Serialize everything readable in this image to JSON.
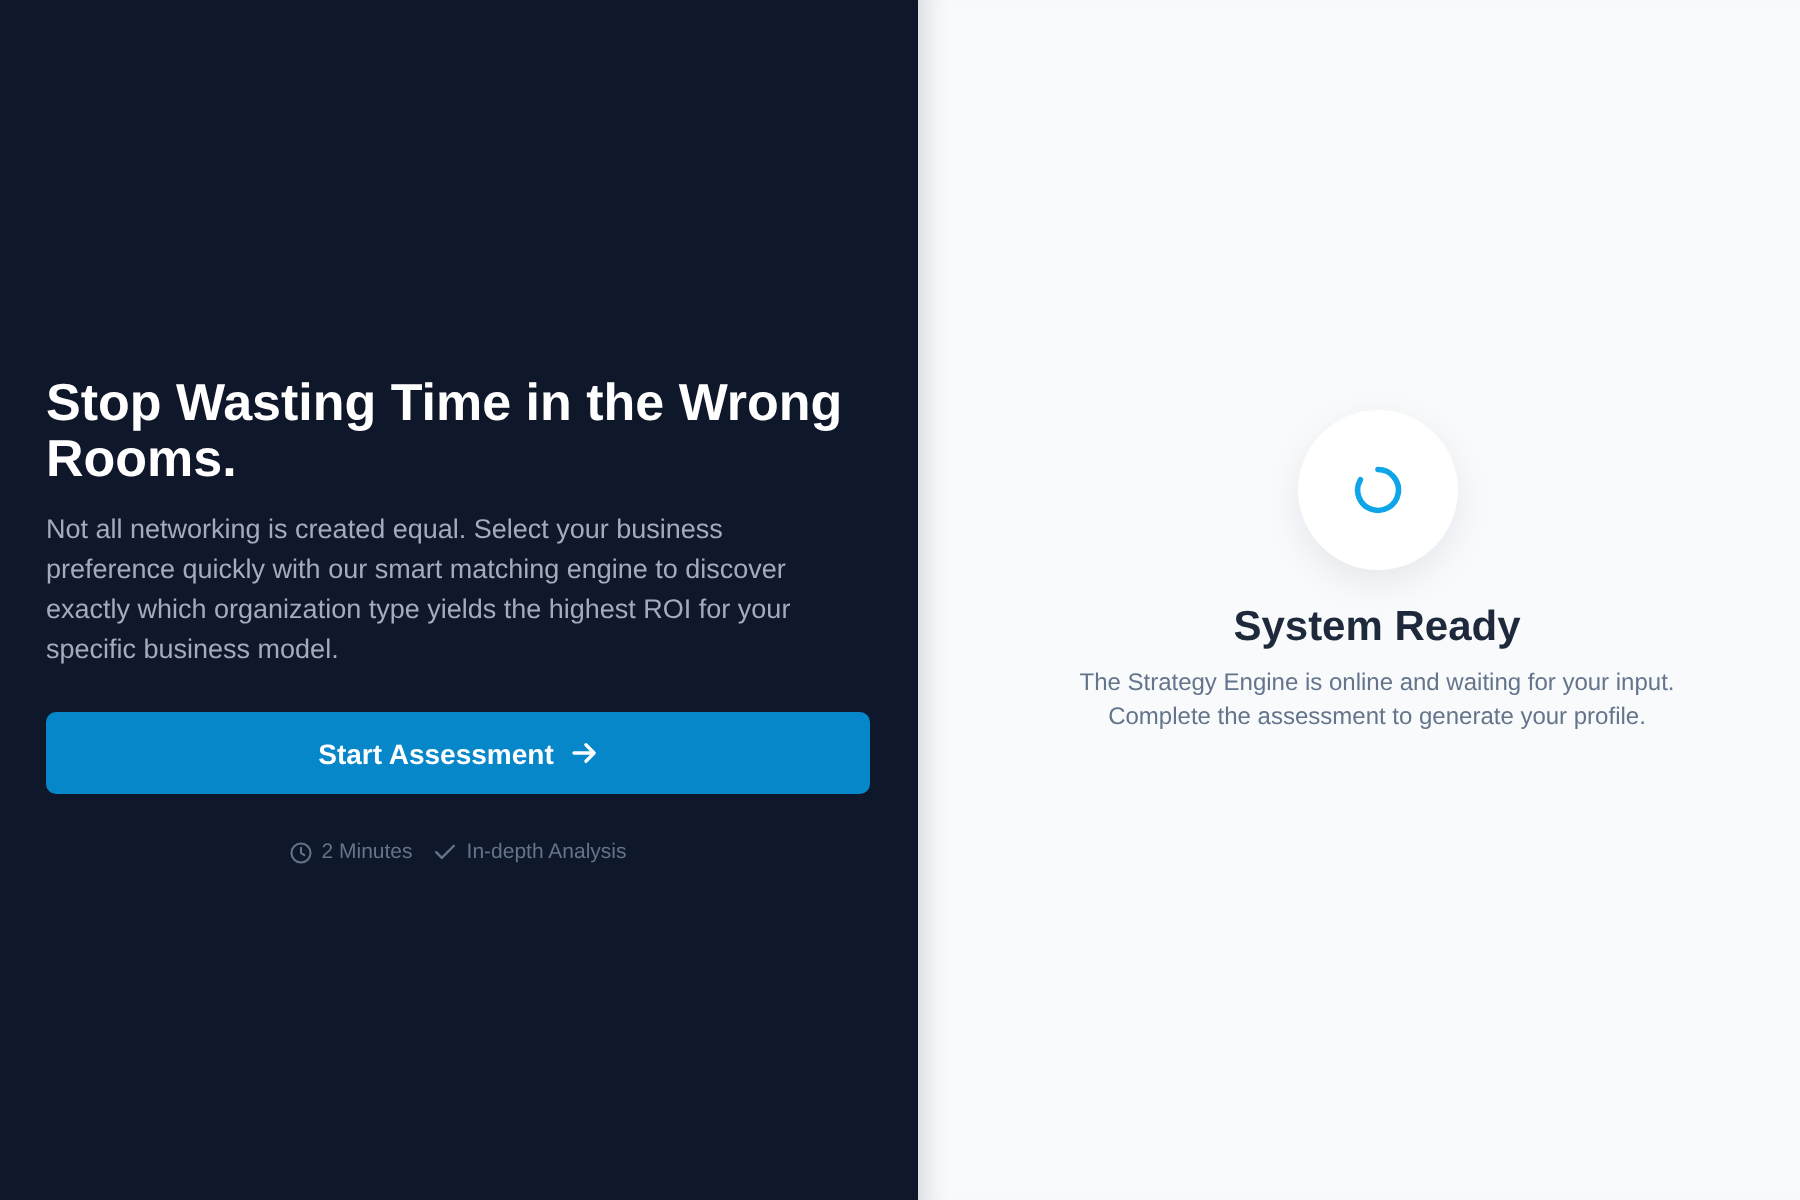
{
  "hero": {
    "heading": "Stop Wasting Time in the Wrong Rooms.",
    "description": "Not all networking is created equal. Select your business preference quickly with our smart matching engine to discover exactly which organization type yields the highest ROI for your specific business model.",
    "button": {
      "label": "Start Assessment"
    },
    "meta": [
      {
        "kind": "clock",
        "label": "2 Minutes"
      },
      {
        "kind": "check",
        "label": "In-depth Analysis"
      }
    ]
  },
  "status": {
    "title": "System Ready",
    "description": "The Strategy Engine is online and waiting for your input. Complete the assessment to generate your profile."
  }
}
